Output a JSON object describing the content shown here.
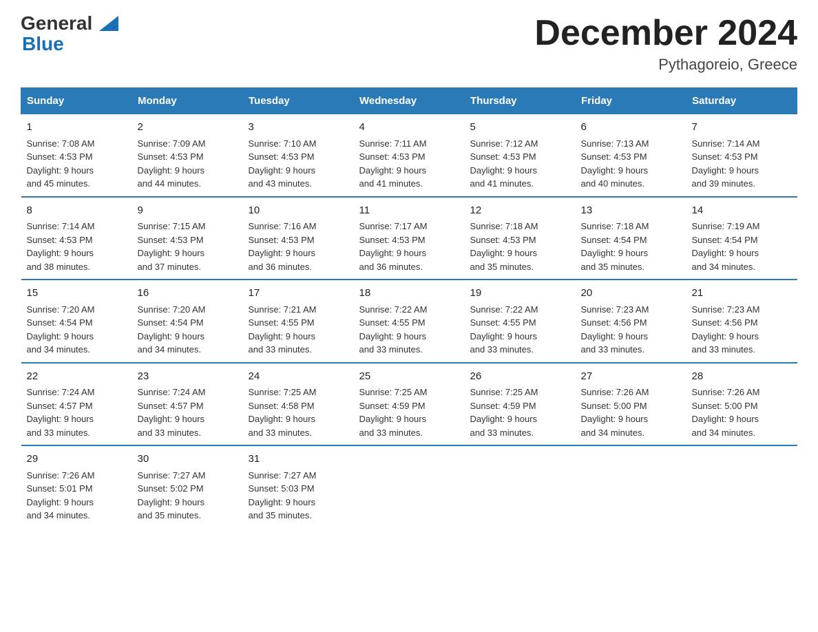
{
  "header": {
    "logo_general": "General",
    "logo_blue": "Blue",
    "month_title": "December 2024",
    "location": "Pythagoreio, Greece"
  },
  "calendar": {
    "days_of_week": [
      "Sunday",
      "Monday",
      "Tuesday",
      "Wednesday",
      "Thursday",
      "Friday",
      "Saturday"
    ],
    "weeks": [
      [
        {
          "day": "1",
          "sunrise": "7:08 AM",
          "sunset": "4:53 PM",
          "daylight": "9 hours and 45 minutes."
        },
        {
          "day": "2",
          "sunrise": "7:09 AM",
          "sunset": "4:53 PM",
          "daylight": "9 hours and 44 minutes."
        },
        {
          "day": "3",
          "sunrise": "7:10 AM",
          "sunset": "4:53 PM",
          "daylight": "9 hours and 43 minutes."
        },
        {
          "day": "4",
          "sunrise": "7:11 AM",
          "sunset": "4:53 PM",
          "daylight": "9 hours and 41 minutes."
        },
        {
          "day": "5",
          "sunrise": "7:12 AM",
          "sunset": "4:53 PM",
          "daylight": "9 hours and 41 minutes."
        },
        {
          "day": "6",
          "sunrise": "7:13 AM",
          "sunset": "4:53 PM",
          "daylight": "9 hours and 40 minutes."
        },
        {
          "day": "7",
          "sunrise": "7:14 AM",
          "sunset": "4:53 PM",
          "daylight": "9 hours and 39 minutes."
        }
      ],
      [
        {
          "day": "8",
          "sunrise": "7:14 AM",
          "sunset": "4:53 PM",
          "daylight": "9 hours and 38 minutes."
        },
        {
          "day": "9",
          "sunrise": "7:15 AM",
          "sunset": "4:53 PM",
          "daylight": "9 hours and 37 minutes."
        },
        {
          "day": "10",
          "sunrise": "7:16 AM",
          "sunset": "4:53 PM",
          "daylight": "9 hours and 36 minutes."
        },
        {
          "day": "11",
          "sunrise": "7:17 AM",
          "sunset": "4:53 PM",
          "daylight": "9 hours and 36 minutes."
        },
        {
          "day": "12",
          "sunrise": "7:18 AM",
          "sunset": "4:53 PM",
          "daylight": "9 hours and 35 minutes."
        },
        {
          "day": "13",
          "sunrise": "7:18 AM",
          "sunset": "4:54 PM",
          "daylight": "9 hours and 35 minutes."
        },
        {
          "day": "14",
          "sunrise": "7:19 AM",
          "sunset": "4:54 PM",
          "daylight": "9 hours and 34 minutes."
        }
      ],
      [
        {
          "day": "15",
          "sunrise": "7:20 AM",
          "sunset": "4:54 PM",
          "daylight": "9 hours and 34 minutes."
        },
        {
          "day": "16",
          "sunrise": "7:20 AM",
          "sunset": "4:54 PM",
          "daylight": "9 hours and 34 minutes."
        },
        {
          "day": "17",
          "sunrise": "7:21 AM",
          "sunset": "4:55 PM",
          "daylight": "9 hours and 33 minutes."
        },
        {
          "day": "18",
          "sunrise": "7:22 AM",
          "sunset": "4:55 PM",
          "daylight": "9 hours and 33 minutes."
        },
        {
          "day": "19",
          "sunrise": "7:22 AM",
          "sunset": "4:55 PM",
          "daylight": "9 hours and 33 minutes."
        },
        {
          "day": "20",
          "sunrise": "7:23 AM",
          "sunset": "4:56 PM",
          "daylight": "9 hours and 33 minutes."
        },
        {
          "day": "21",
          "sunrise": "7:23 AM",
          "sunset": "4:56 PM",
          "daylight": "9 hours and 33 minutes."
        }
      ],
      [
        {
          "day": "22",
          "sunrise": "7:24 AM",
          "sunset": "4:57 PM",
          "daylight": "9 hours and 33 minutes."
        },
        {
          "day": "23",
          "sunrise": "7:24 AM",
          "sunset": "4:57 PM",
          "daylight": "9 hours and 33 minutes."
        },
        {
          "day": "24",
          "sunrise": "7:25 AM",
          "sunset": "4:58 PM",
          "daylight": "9 hours and 33 minutes."
        },
        {
          "day": "25",
          "sunrise": "7:25 AM",
          "sunset": "4:59 PM",
          "daylight": "9 hours and 33 minutes."
        },
        {
          "day": "26",
          "sunrise": "7:25 AM",
          "sunset": "4:59 PM",
          "daylight": "9 hours and 33 minutes."
        },
        {
          "day": "27",
          "sunrise": "7:26 AM",
          "sunset": "5:00 PM",
          "daylight": "9 hours and 34 minutes."
        },
        {
          "day": "28",
          "sunrise": "7:26 AM",
          "sunset": "5:00 PM",
          "daylight": "9 hours and 34 minutes."
        }
      ],
      [
        {
          "day": "29",
          "sunrise": "7:26 AM",
          "sunset": "5:01 PM",
          "daylight": "9 hours and 34 minutes."
        },
        {
          "day": "30",
          "sunrise": "7:27 AM",
          "sunset": "5:02 PM",
          "daylight": "9 hours and 35 minutes."
        },
        {
          "day": "31",
          "sunrise": "7:27 AM",
          "sunset": "5:03 PM",
          "daylight": "9 hours and 35 minutes."
        },
        null,
        null,
        null,
        null
      ]
    ]
  },
  "labels": {
    "sunrise": "Sunrise:",
    "sunset": "Sunset:",
    "daylight": "Daylight:"
  }
}
